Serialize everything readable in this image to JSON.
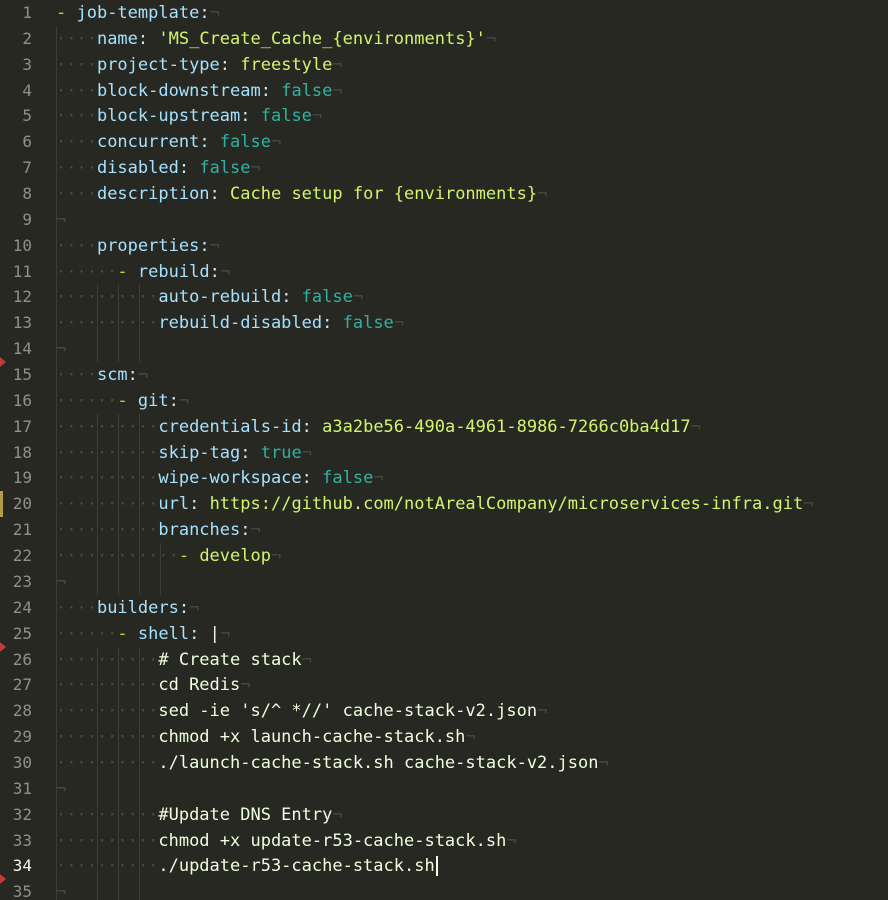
{
  "colors": {
    "background": "#272822",
    "line_number": "#8f908a",
    "key": "#a6e1ff",
    "string": "#d2f56b",
    "boolean": "#2cb3a2",
    "dash": "#a6e22e"
  },
  "editor": {
    "language": "yaml",
    "active_line": 34,
    "lines": [
      {
        "n": "1",
        "text": "- job-template:"
      },
      {
        "n": "2",
        "text": "    name: 'MS_Create_Cache_{environments}'"
      },
      {
        "n": "3",
        "text": "    project-type: freestyle"
      },
      {
        "n": "4",
        "text": "    block-downstream: false"
      },
      {
        "n": "5",
        "text": "    block-upstream: false"
      },
      {
        "n": "6",
        "text": "    concurrent: false"
      },
      {
        "n": "7",
        "text": "    disabled: false"
      },
      {
        "n": "8",
        "text": "    description: Cache setup for {environments}"
      },
      {
        "n": "9",
        "text": ""
      },
      {
        "n": "10",
        "text": "    properties:"
      },
      {
        "n": "11",
        "text": "      - rebuild:"
      },
      {
        "n": "12",
        "text": "          auto-rebuild: false"
      },
      {
        "n": "13",
        "text": "          rebuild-disabled: false"
      },
      {
        "n": "14",
        "text": ""
      },
      {
        "n": "15",
        "text": "    scm:"
      },
      {
        "n": "16",
        "text": "      - git:"
      },
      {
        "n": "17",
        "text": "          credentials-id: a3a2be56-490a-4961-8986-7266c0ba4d17"
      },
      {
        "n": "18",
        "text": "          skip-tag: true"
      },
      {
        "n": "19",
        "text": "          wipe-workspace: false"
      },
      {
        "n": "20",
        "text": "          url: https://github.com/notArealCompany/microservices-infra.git"
      },
      {
        "n": "21",
        "text": "          branches:"
      },
      {
        "n": "22",
        "text": "            - develop"
      },
      {
        "n": "23",
        "text": ""
      },
      {
        "n": "24",
        "text": "    builders:"
      },
      {
        "n": "25",
        "text": "      - shell: |"
      },
      {
        "n": "26",
        "text": "          # Create stack"
      },
      {
        "n": "27",
        "text": "          cd Redis"
      },
      {
        "n": "28",
        "text": "          sed -ie 's/^ *//' cache-stack-v2.json"
      },
      {
        "n": "29",
        "text": "          chmod +x launch-cache-stack.sh"
      },
      {
        "n": "30",
        "text": "          ./launch-cache-stack.sh cache-stack-v2.json"
      },
      {
        "n": "31",
        "text": ""
      },
      {
        "n": "32",
        "text": "          #Update DNS Entry"
      },
      {
        "n": "33",
        "text": "          chmod +x update-r53-cache-stack.sh"
      },
      {
        "n": "34",
        "text": "          ./update-r53-cache-stack.sh"
      },
      {
        "n": "35",
        "text": ""
      }
    ]
  }
}
